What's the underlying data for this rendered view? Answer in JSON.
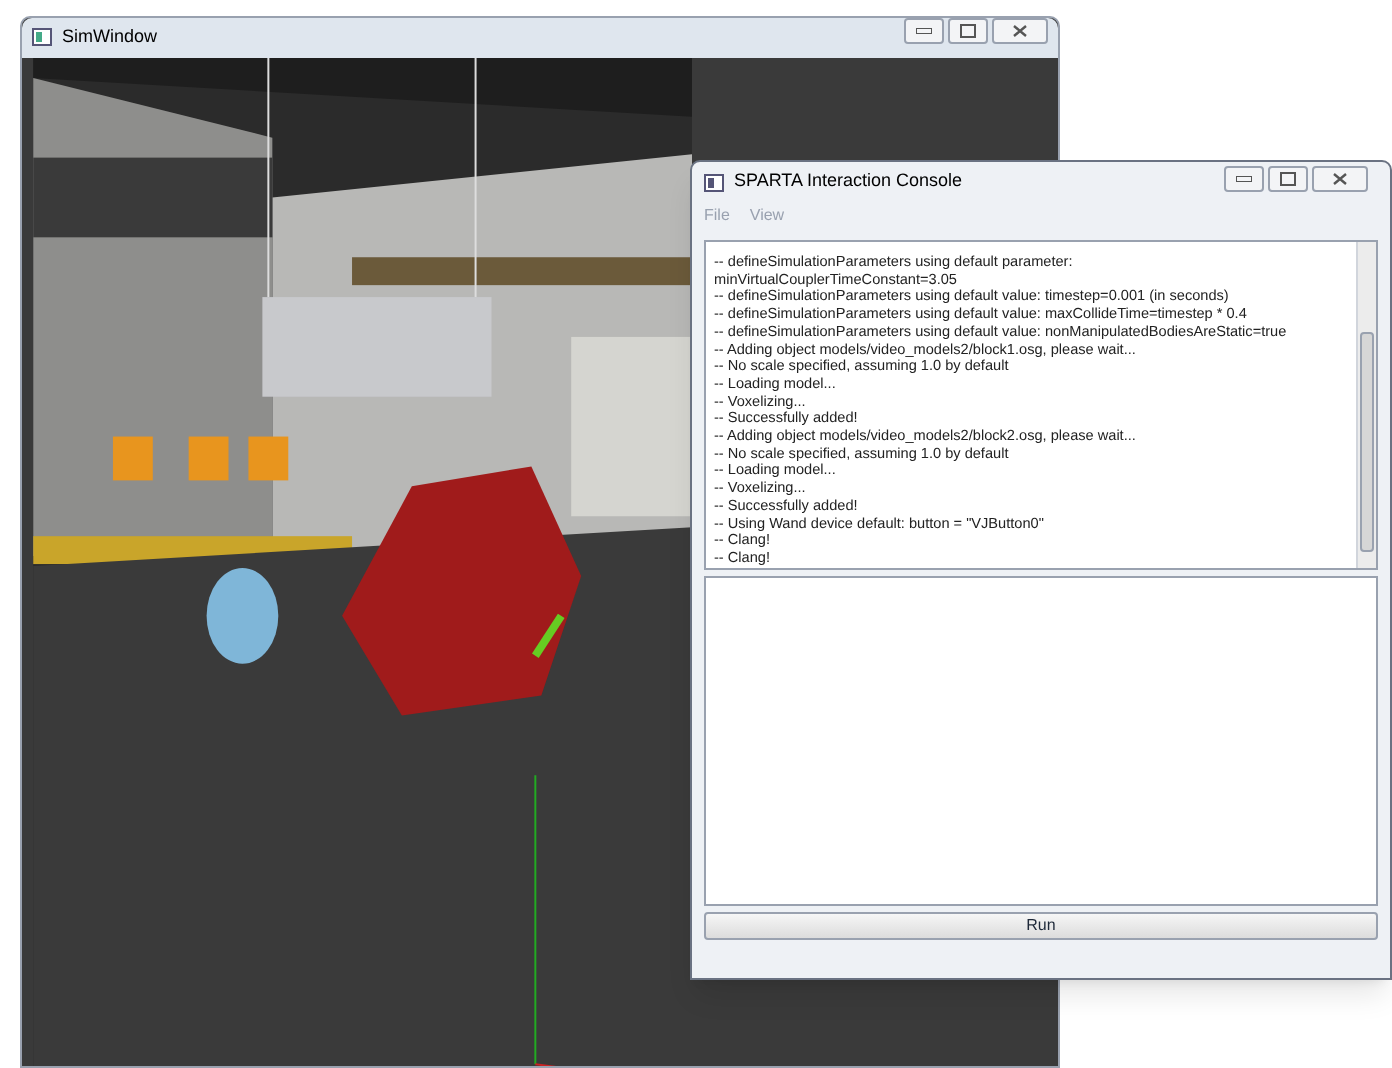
{
  "sim_window": {
    "title": "SimWindow"
  },
  "console_window": {
    "title": "SPARTA Interaction Console",
    "menu": [
      {
        "label": "File",
        "disabled": true
      },
      {
        "label": "View",
        "disabled": true
      }
    ],
    "output_lines": [
      "-- defineSimulationParameters using default parameter:",
      "minVirtualCouplerTimeConstant=3.05",
      "-- defineSimulationParameters using default value: timestep=0.001 (in seconds)",
      "-- defineSimulationParameters using default value: maxCollideTime=timestep * 0.4",
      "-- defineSimulationParameters using default value: nonManipulatedBodiesAreStatic=true",
      "-- Adding object models/video_models2/block1.osg, please wait...",
      "-- No scale specified, assuming 1.0 by default",
      "-- Loading model...",
      "-- Voxelizing...",
      "-- Successfully added!",
      "-- Adding object models/video_models2/block2.osg, please wait...",
      "-- No scale specified, assuming 1.0 by default",
      "-- Loading model...",
      "-- Voxelizing...",
      "-- Successfully added!",
      "-- Using Wand device default: button = \"VJButton0\"",
      "-- Clang!",
      "-- Clang!"
    ],
    "run_button": "Run"
  }
}
